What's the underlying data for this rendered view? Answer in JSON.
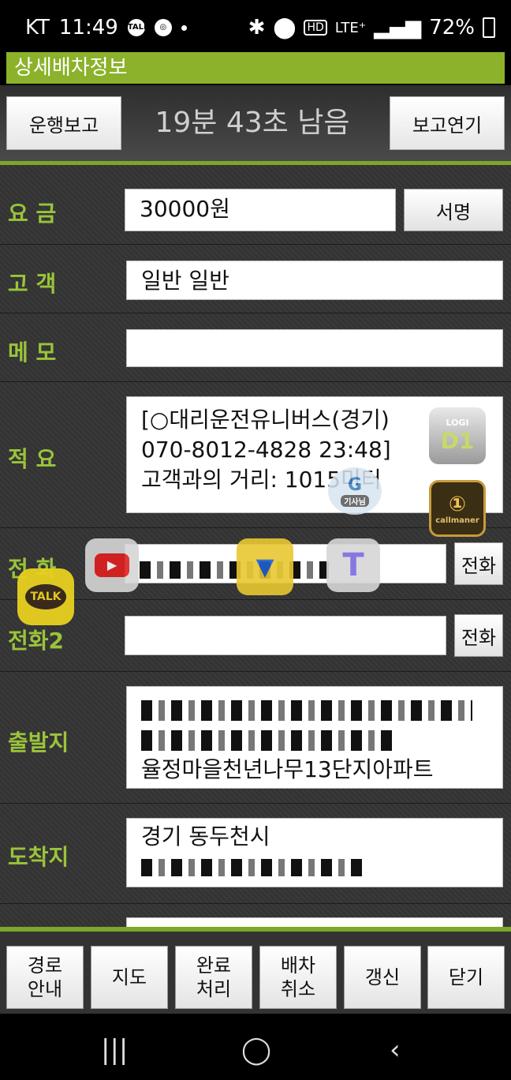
{
  "status": {
    "carrier": "KT",
    "time": "11:49",
    "icons_left": [
      "talk-icon",
      "steering-icon"
    ],
    "talk_text": "TALK",
    "network": "LTE⁺",
    "hd": "HD",
    "battery": "72%"
  },
  "app_title": "상세배차정보",
  "header": {
    "report_button": "운행보고",
    "timer": "19분 43초 남음",
    "delay_button": "보고연기"
  },
  "fee": {
    "label": "요 금",
    "value": "30000원",
    "button": "서명"
  },
  "customer": {
    "label": "고 객",
    "value": "일반 일반"
  },
  "memo": {
    "label": "메 모",
    "value": ""
  },
  "summary": {
    "label": "적 요",
    "lines": [
      "[○대리운전유니버스(경기)",
      "070-8012-4828    23:48]",
      "고객과의 거리: 1015미터"
    ]
  },
  "phone": {
    "label": "전 화",
    "button": "전화"
  },
  "phone2": {
    "label": "전화2",
    "value": "",
    "button": "전화"
  },
  "departure": {
    "label": "출발지",
    "line3": "율정마을천년나무13단지아파트"
  },
  "arrival": {
    "label": "도착지",
    "line1": "경기 동두천시"
  },
  "bottom": {
    "route": "경로\n안내",
    "map": "지도",
    "complete": "완료\n처리",
    "cancel": "배차\n취소",
    "refresh": "갱신",
    "close": "닫기"
  },
  "overlays": {
    "logi": "LOGI",
    "d1": "D1",
    "kisanim": "기사님",
    "callmanager": "callmaner",
    "talk": "TALK",
    "t": "T"
  },
  "colors": {
    "accent": "#8bb22a",
    "label": "#9ac43a"
  }
}
